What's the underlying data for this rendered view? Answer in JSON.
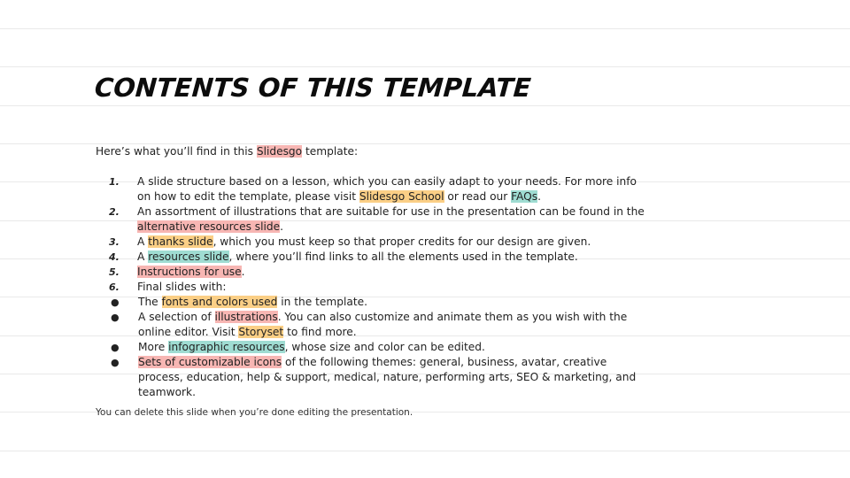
{
  "title": "CONTENTS OF THIS TEMPLATE",
  "intro": {
    "before": "Here’s what you’ll find in this ",
    "highlight": "Slidesgo",
    "after": " template:"
  },
  "items": [
    {
      "num": "1.",
      "t1": "A slide structure based on a lesson, which you can easily adapt to your needs. For more info on how to edit the template, please visit ",
      "h1": "Slidesgo School",
      "t2": " or read our ",
      "h2": "FAQs",
      "t3": "."
    },
    {
      "num": "2.",
      "t1": "An assortment of illustrations that are suitable for use in the presentation can be found in the ",
      "h1": "alternative resources slide",
      "t2": "."
    },
    {
      "num": "3.",
      "t1": "A ",
      "h1": "thanks slide",
      "t2": ", which you must keep so that proper credits for our design are given."
    },
    {
      "num": "4.",
      "t1": "A ",
      "h1": "resources slide",
      "t2": ", where you’ll find links to all the elements used in the template."
    },
    {
      "num": "5.",
      "h1": "Instructions for use",
      "t2": "."
    },
    {
      "num": "6.",
      "t1": "Final slides with:"
    }
  ],
  "subitems": [
    {
      "bullet": "●",
      "t1": "The ",
      "h1": "fonts and colors used",
      "t2": " in the template."
    },
    {
      "bullet": "●",
      "t1": "A selection of ",
      "h1": "illustrations",
      "t2": ". You can also customize and animate them as you wish with the online editor. Visit ",
      "h2": "Storyset",
      "t3": " to find more."
    },
    {
      "bullet": "●",
      "t1": "More ",
      "h1": "infographic resources",
      "t2": ", whose size and color can be edited."
    },
    {
      "bullet": "●",
      "h1": "Sets of customizable icons",
      "t2": " of the following themes: general, business, avatar, creative process, education, help & support, medical, nature, performing arts, SEO & marketing, and teamwork."
    }
  ],
  "footer": "You can delete this slide when you’re done editing the presentation."
}
